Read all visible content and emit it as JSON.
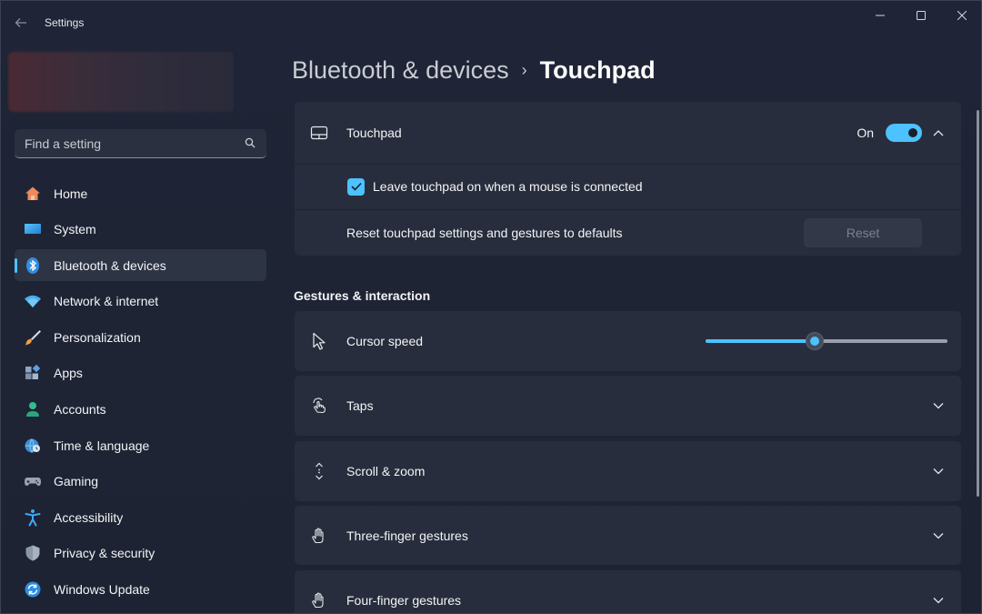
{
  "window": {
    "title": "Settings"
  },
  "search": {
    "placeholder": "Find a setting"
  },
  "sidebar": {
    "items": [
      {
        "label": "Home",
        "icon": "home-icon",
        "active": false
      },
      {
        "label": "System",
        "icon": "system-icon",
        "active": false
      },
      {
        "label": "Bluetooth & devices",
        "icon": "bluetooth-icon",
        "active": true
      },
      {
        "label": "Network & internet",
        "icon": "wifi-icon",
        "active": false
      },
      {
        "label": "Personalization",
        "icon": "brush-icon",
        "active": false
      },
      {
        "label": "Apps",
        "icon": "apps-icon",
        "active": false
      },
      {
        "label": "Accounts",
        "icon": "person-icon",
        "active": false
      },
      {
        "label": "Time & language",
        "icon": "globe-clock-icon",
        "active": false
      },
      {
        "label": "Gaming",
        "icon": "gamepad-icon",
        "active": false
      },
      {
        "label": "Accessibility",
        "icon": "accessibility-icon",
        "active": false
      },
      {
        "label": "Privacy & security",
        "icon": "shield-icon",
        "active": false
      },
      {
        "label": "Windows Update",
        "icon": "update-icon",
        "active": false
      }
    ]
  },
  "breadcrumb": {
    "parent": "Bluetooth & devices",
    "separator": "›",
    "current": "Touchpad"
  },
  "touchpad": {
    "label": "Touchpad",
    "toggle_text": "On",
    "toggle_on": true,
    "expanded": true,
    "leave_on_label": "Leave touchpad on when a mouse is connected",
    "leave_on_checked": true,
    "reset_label": "Reset touchpad settings and gestures to defaults",
    "reset_button": "Reset"
  },
  "gestures": {
    "title": "Gestures & interaction",
    "cursor_speed": {
      "label": "Cursor speed",
      "value_fraction": 0.45
    },
    "rows": [
      {
        "label": "Taps",
        "icon": "tap-icon"
      },
      {
        "label": "Scroll & zoom",
        "icon": "scroll-icon"
      },
      {
        "label": "Three-finger gestures",
        "icon": "hand-icon"
      },
      {
        "label": "Four-finger gestures",
        "icon": "hand-icon"
      }
    ]
  },
  "colors": {
    "accent": "#4cc2ff",
    "background": "#1e2433",
    "card": "#272d3c"
  }
}
